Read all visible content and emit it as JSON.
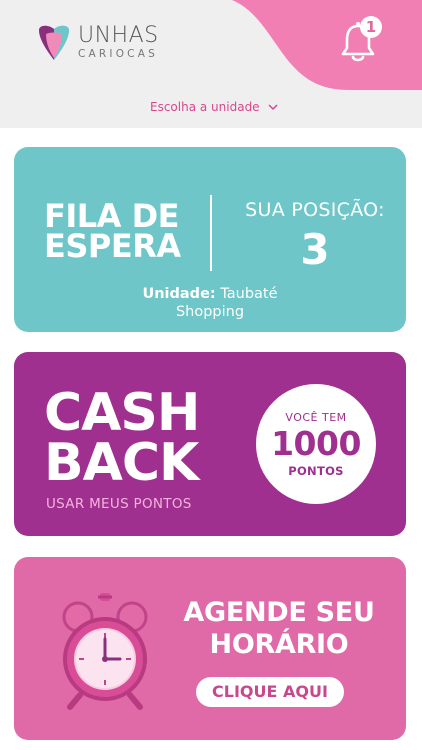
{
  "header": {
    "brand_main": "UNHAS",
    "brand_sub": "CARIOCAS",
    "notification_count": "1",
    "unit_selector": "Escolha a unidade"
  },
  "queue_card": {
    "title_line1": "FILA DE",
    "title_line2": "ESPERA",
    "position_label": "SUA POSIÇÃO:",
    "position_value": "3",
    "unit_label": "Unidade:",
    "unit_name_line1": "Taubaté",
    "unit_name_line2": "Shopping"
  },
  "cashback_card": {
    "title_line1": "CASH",
    "title_line2": "BACK",
    "use_points_link": "USAR MEUS PONTOS",
    "points_prefix": "VOCÊ TEM",
    "points_value": "1000",
    "points_suffix": "PONTOS"
  },
  "schedule_card": {
    "title_line1": "AGENDE SEU",
    "title_line2": "HORÁRIO",
    "button_label": "CLIQUE AQUI"
  },
  "colors": {
    "header_pink": "#f27fb4",
    "queue": "#6ec6c9",
    "cashback": "#a0308f",
    "schedule": "#e06aa8",
    "accent_text": "#d7488d"
  },
  "icons": [
    "brand-logo-icon",
    "bell-icon",
    "chevron-down-icon",
    "alarm-clock-icon"
  ]
}
